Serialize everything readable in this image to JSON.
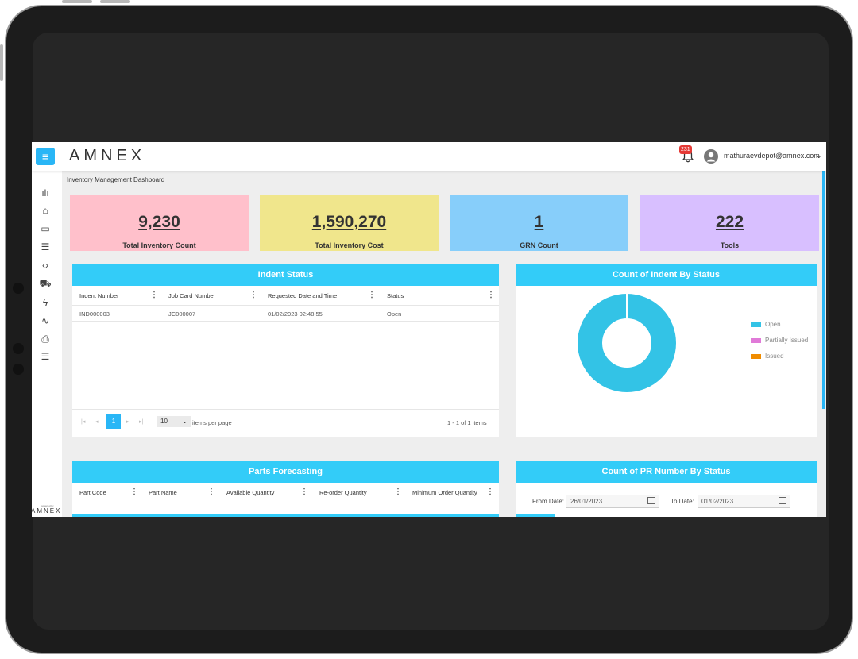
{
  "app": {
    "logo": "AMNEX",
    "notifications_count": "231",
    "user_email": "mathuraevdepot@amnex.com",
    "breadcrumb": "Inventory Management Dashboard"
  },
  "sidebar": {
    "logo": "AMNEX",
    "logo_caption": "powered by",
    "items": [
      {
        "icon": "bar-chart-icon",
        "glyph": "ılı"
      },
      {
        "icon": "home-icon",
        "glyph": "⌂"
      },
      {
        "icon": "map-icon",
        "glyph": "▭"
      },
      {
        "icon": "sliders-icon",
        "glyph": "☰"
      },
      {
        "icon": "code-icon",
        "glyph": "‹›"
      },
      {
        "icon": "truck-icon",
        "glyph": "⛟"
      },
      {
        "icon": "lightning-icon",
        "glyph": "ϟ"
      },
      {
        "icon": "activity-icon",
        "glyph": "∿"
      },
      {
        "icon": "file-plus-icon",
        "glyph": "⎙"
      },
      {
        "icon": "settings-sliders-icon",
        "glyph": "☰"
      }
    ]
  },
  "kpis": [
    {
      "value": "9,230",
      "label": "Total Inventory Count",
      "color": "#ffc0cb"
    },
    {
      "value": "1,590,270",
      "label": "Total Inventory Cost",
      "color": "#f0e68c"
    },
    {
      "value": "1",
      "label": "GRN Count",
      "color": "#87cefa"
    },
    {
      "value": "222",
      "label": "Tools",
      "color": "#d8bfff"
    }
  ],
  "indent_status": {
    "title": "Indent Status",
    "columns": [
      "Indent Number",
      "Job Card Number",
      "Requested Date and Time",
      "Status"
    ],
    "rows": [
      [
        "IND000003",
        "JC000007",
        "01/02/2023 02:48:55",
        "Open"
      ]
    ],
    "pager": {
      "page": "1",
      "page_size": "10",
      "items_per_page_label": "items per page",
      "range": "1 - 1 of 1 items"
    }
  },
  "indent_chart": {
    "title": "Count of Indent By Status"
  },
  "chart_data": {
    "type": "pie",
    "title": "Count of Indent By Status",
    "categories": [
      "Open",
      "Partially Issued",
      "Issued"
    ],
    "values": [
      1,
      0,
      0
    ],
    "colors": [
      "#33c3e6",
      "#e07ad8",
      "#f08c00"
    ],
    "legend": "right"
  },
  "parts_forecasting": {
    "title": "Parts Forecasting",
    "columns": [
      "Part Code",
      "Part Name",
      "Available Quantity",
      "Re-order Quantity",
      "Minimum Order Quantity"
    ]
  },
  "pr_status": {
    "title": "Count of PR Number By Status",
    "from_label": "From Date:",
    "from_value": "26/01/2023",
    "to_label": "To Date:",
    "to_value": "01/02/2023"
  }
}
